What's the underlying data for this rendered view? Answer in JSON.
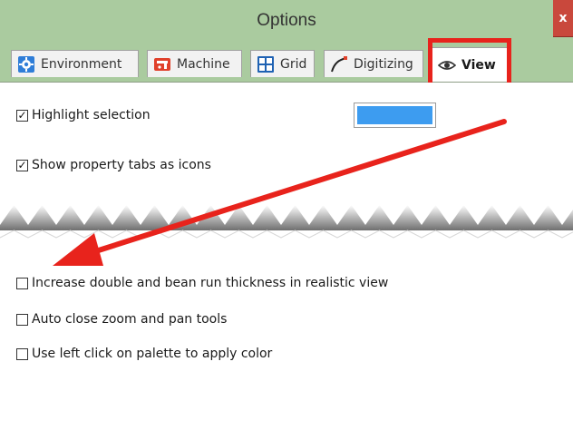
{
  "window": {
    "title": "Options",
    "close_glyph": "x"
  },
  "tabs": [
    {
      "label": "Environment",
      "icon": "gear-icon",
      "active": false
    },
    {
      "label": "Machine",
      "icon": "machine-icon",
      "active": false
    },
    {
      "label": "Grid",
      "icon": "grid-icon",
      "active": false
    },
    {
      "label": "Digitizing",
      "icon": "digitizing-icon",
      "active": false
    },
    {
      "label": "View",
      "icon": "eye-icon",
      "active": true
    }
  ],
  "options": {
    "highlight_selection": {
      "label": "Highlight selection",
      "checked": true,
      "color": "#3d9cf0"
    },
    "show_property_tabs": {
      "label": "Show property tabs as icons",
      "checked": true
    },
    "increase_thickness": {
      "label": "Increase double and bean run thickness in realistic view",
      "checked": false
    },
    "auto_close_zoom": {
      "label": "Auto close zoom and pan tools",
      "checked": false
    },
    "left_click_palette": {
      "label": "Use left click on palette to apply color",
      "checked": false
    }
  },
  "colors": {
    "titlebar": "#aacb9f",
    "annotation_red": "#e8231c",
    "swatch": "#3d9cf0"
  }
}
